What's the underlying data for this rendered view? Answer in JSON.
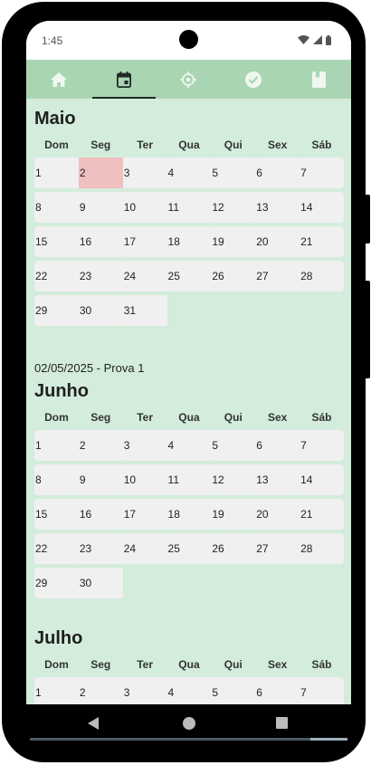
{
  "status_bar": {
    "time": "1:45",
    "icons": [
      "wifi-icon",
      "signal-icon",
      "battery-icon"
    ]
  },
  "tabs": [
    {
      "icon": "home-icon",
      "active": false
    },
    {
      "icon": "calendar-icon",
      "active": true
    },
    {
      "icon": "target-icon",
      "active": false
    },
    {
      "icon": "check-circle-icon",
      "active": false
    },
    {
      "icon": "book-icon",
      "active": false
    }
  ],
  "weekdays": [
    "Dom",
    "Seg",
    "Ter",
    "Qua",
    "Qui",
    "Sex",
    "Sáb"
  ],
  "months": [
    {
      "title": "Maio",
      "days": [
        [
          "1",
          "2",
          "3",
          "4",
          "5",
          "6",
          "7"
        ],
        [
          "8",
          "9",
          "10",
          "11",
          "12",
          "13",
          "14"
        ],
        [
          "15",
          "16",
          "17",
          "18",
          "19",
          "20",
          "21"
        ],
        [
          "22",
          "23",
          "24",
          "25",
          "26",
          "27",
          "28"
        ],
        [
          "29",
          "30",
          "31"
        ]
      ],
      "selected_day": "2",
      "events": [
        "02/05/2025 - Prova 1"
      ]
    },
    {
      "title": "Junho",
      "days": [
        [
          "1",
          "2",
          "3",
          "4",
          "5",
          "6",
          "7"
        ],
        [
          "8",
          "9",
          "10",
          "11",
          "12",
          "13",
          "14"
        ],
        [
          "15",
          "16",
          "17",
          "18",
          "19",
          "20",
          "21"
        ],
        [
          "22",
          "23",
          "24",
          "25",
          "26",
          "27",
          "28"
        ],
        [
          "29",
          "30"
        ]
      ],
      "selected_day": null,
      "events": []
    },
    {
      "title": "Julho",
      "days": [
        [
          "1",
          "2",
          "3",
          "4",
          "5",
          "6",
          "7"
        ]
      ],
      "selected_day": null,
      "events": []
    }
  ],
  "colors": {
    "app_bar": "#a9d5b3",
    "background": "#d3ecdb",
    "day_cell": "#f0f0f0",
    "selected_day": "#f0bfbf"
  }
}
